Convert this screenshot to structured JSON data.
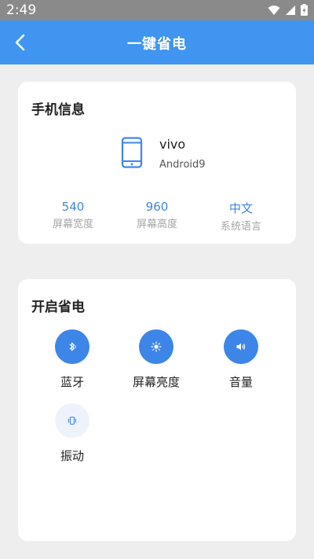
{
  "status": {
    "time": "2:49"
  },
  "header": {
    "title": "一键省电"
  },
  "phone_info": {
    "title": "手机信息",
    "brand": "vivo",
    "os": "Android9",
    "specs": [
      {
        "value": "540",
        "label": "屏幕宽度"
      },
      {
        "value": "960",
        "label": "屏幕高度"
      },
      {
        "value": "中文",
        "label": "系统语言"
      }
    ]
  },
  "power_save": {
    "title": "开启省电",
    "toggles": [
      {
        "label": "蓝牙",
        "icon": "bluetooth-icon",
        "active": true
      },
      {
        "label": "屏幕亮度",
        "icon": "brightness-icon",
        "active": true
      },
      {
        "label": "音量",
        "icon": "volume-icon",
        "active": true
      },
      {
        "label": "振动",
        "icon": "vibration-icon",
        "active": false
      }
    ]
  },
  "colors": {
    "accent": "#3f95f0",
    "toggle_on": "#3d86e8",
    "spec_value": "#3f86e0"
  }
}
